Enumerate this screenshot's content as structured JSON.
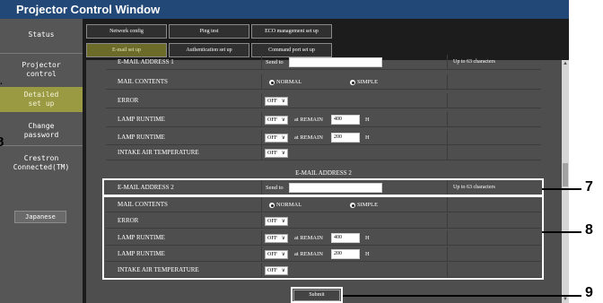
{
  "window": {
    "title": "Projector Control Window"
  },
  "sidebar": {
    "items": [
      {
        "label": "Status"
      },
      {
        "label": "Projector\ncontrol"
      },
      {
        "label": "Detailed\nset up"
      },
      {
        "label": "Change\npassword"
      },
      {
        "label": "Crestron\nConnected(TM)"
      }
    ],
    "language_button": "Japanese"
  },
  "tabs": [
    {
      "label": "Network config"
    },
    {
      "label": "Ping test"
    },
    {
      "label": "ECO management set up"
    },
    {
      "label": "E-mail set up"
    },
    {
      "label": "Authentication set up"
    },
    {
      "label": "Command port set up"
    }
  ],
  "email1": {
    "address_label": "E-MAIL ADDRESS 1",
    "send_to": "Send to",
    "hint": "Up to 63 characters",
    "rows": {
      "mail_contents": "MAIL CONTENTS",
      "normal": "NORMAL",
      "simple": "SIMPLE",
      "error": "ERROR",
      "lamp1": "LAMP RUNTIME",
      "lamp2": "LAMP RUNTIME",
      "intake": "INTAKE AIR TEMPERATURE"
    },
    "off": "OFF",
    "at_remain": "at REMAIN",
    "remain1": "400",
    "remain2": "200",
    "unit_h": "H"
  },
  "email2": {
    "section_title": "E-MAIL ADDRESS 2",
    "address_label": "E-MAIL ADDRESS 2",
    "send_to": "Send to",
    "hint": "Up to 63 characters",
    "rows": {
      "mail_contents": "MAIL CONTENTS",
      "normal": "NORMAL",
      "simple": "SIMPLE",
      "error": "ERROR",
      "lamp1": "LAMP RUNTIME",
      "lamp2": "LAMP RUNTIME",
      "intake": "INTAKE AIR TEMPERATURE"
    },
    "off": "OFF",
    "at_remain": "at REMAIN",
    "remain1": "400",
    "remain2": "200",
    "unit_h": "H"
  },
  "submit_label": "Submit",
  "callouts": {
    "c7": "7",
    "c8": "8",
    "c9": "9",
    "edge_top": ".",
    "edge_mid": "8"
  },
  "colors": {
    "titlebar": "#224877",
    "active_sidebar": "#9a9a42",
    "active_tab": "#6d6b2a"
  },
  "icons": {
    "dropdown": "chevron-down-icon",
    "radio": "radio-icon"
  }
}
